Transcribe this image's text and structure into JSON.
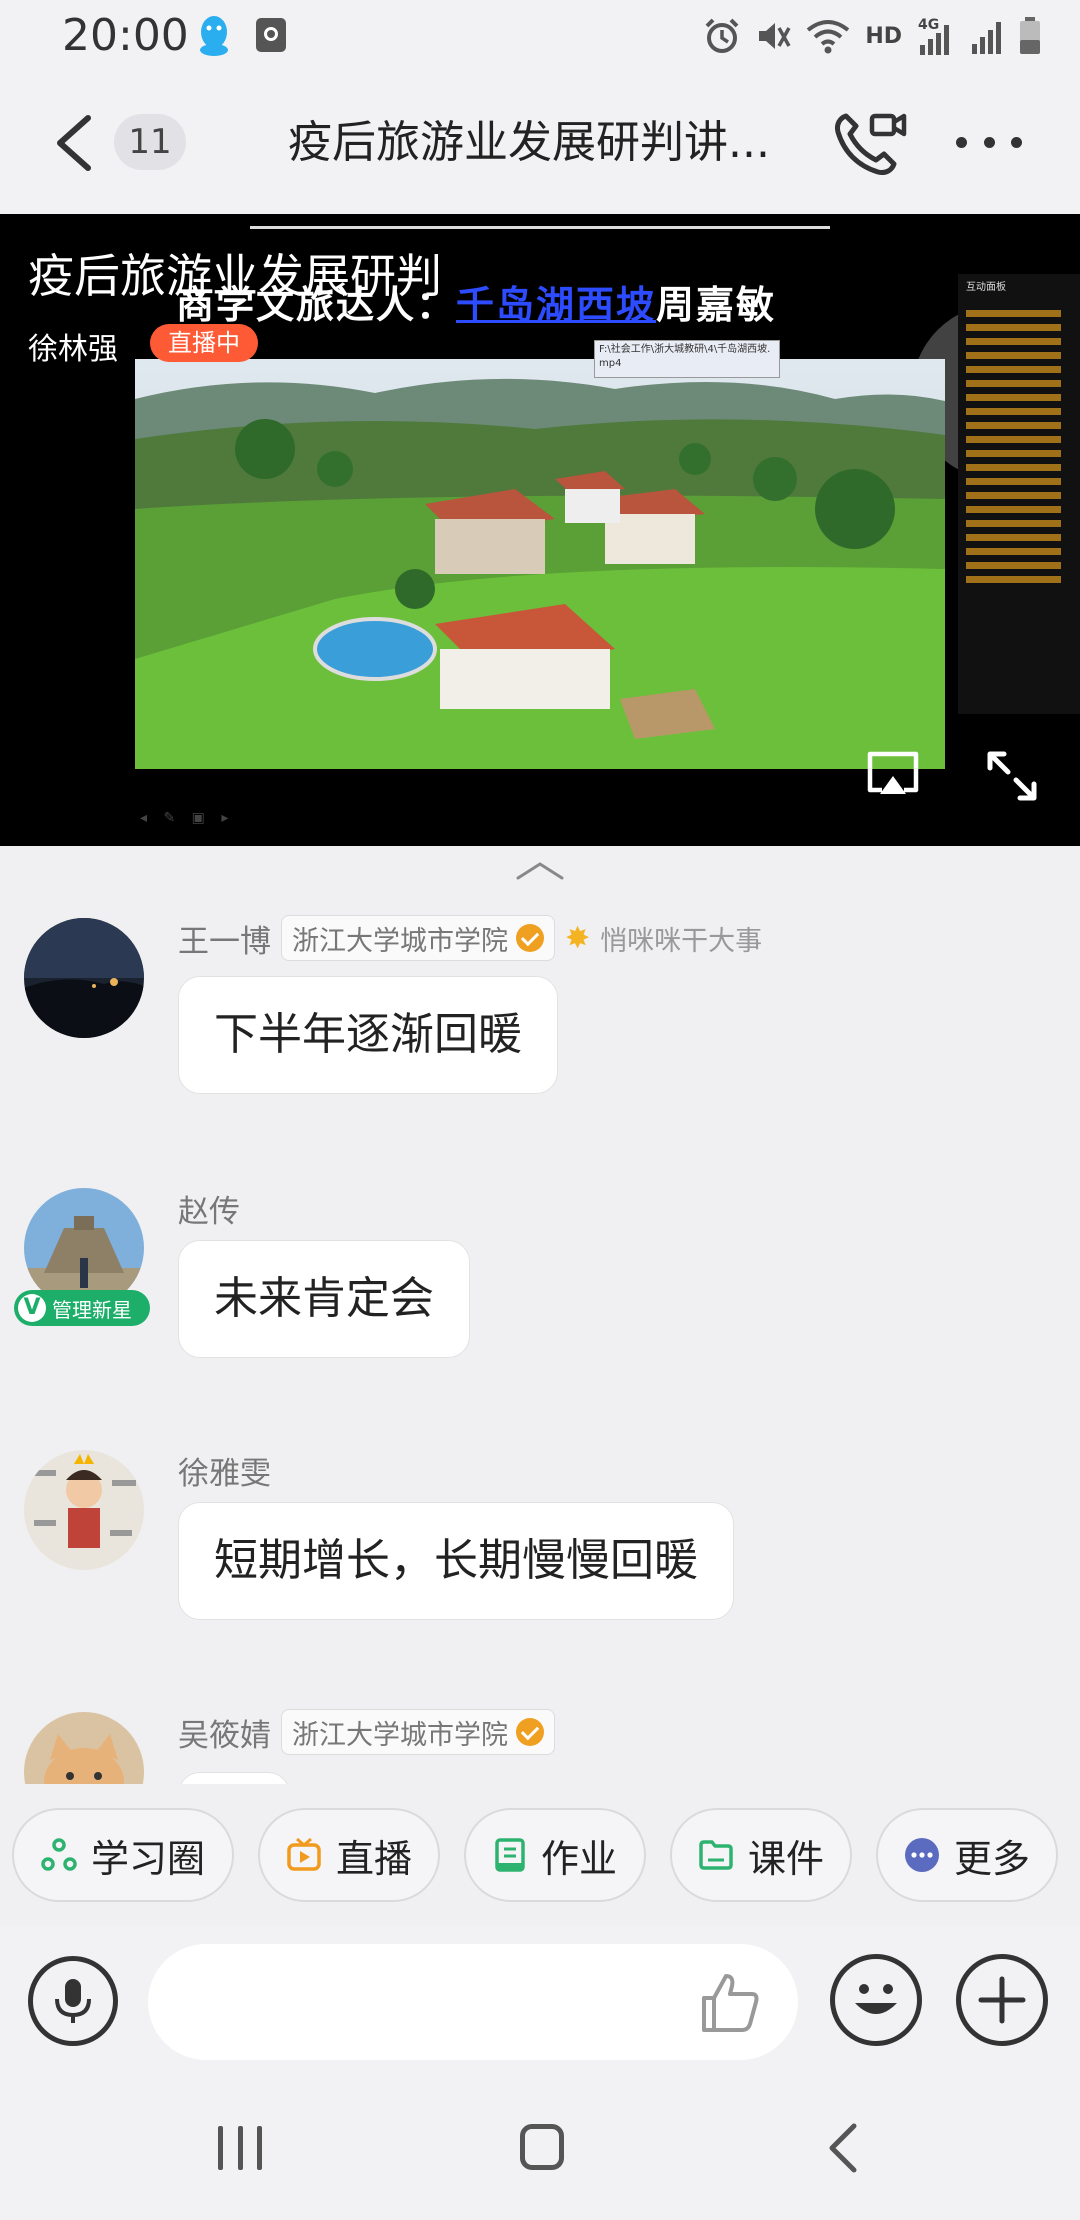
{
  "status_bar": {
    "time": "20:00",
    "network": "HD",
    "network_type": "4G"
  },
  "header": {
    "unread_count": "11",
    "title": "疫后旅游业发展研判讲..."
  },
  "live": {
    "title": "疫后旅游业发展研判",
    "presenter": "徐林强",
    "badge": "直播中",
    "slide_header_prefix": "商学文旅达人：",
    "slide_header_link": "千岛湖西坡",
    "slide_header_suffix": "周嘉敏",
    "slide_tooltip_line1": "F:\\社会工作\\浙大城教研\\4\\千岛湖西坡.",
    "slide_tooltip_line2": "mp4",
    "side_panel_title": "互动面板"
  },
  "messages": [
    {
      "sender": "王一博",
      "school": "浙江大学城市学院",
      "verified": true,
      "title": "悄咪咪干大事",
      "text": "下半年逐渐回暖"
    },
    {
      "sender": "赵传",
      "role_badge": "管理新星",
      "text": "未来肯定会"
    },
    {
      "sender": "徐雅雯",
      "text": "短期增长，长期慢慢回暖"
    },
    {
      "sender": "吴筱婧",
      "school": "浙江大学城市学院",
      "verified": true,
      "text": ""
    }
  ],
  "quick_tabs": [
    {
      "label": "学习圈",
      "icon": "circle-group-icon",
      "color": "#2db36f"
    },
    {
      "label": "直播",
      "icon": "tv-live-icon",
      "color": "#f29a1e"
    },
    {
      "label": "作业",
      "icon": "homework-book-icon",
      "color": "#2db36f"
    },
    {
      "label": "课件",
      "icon": "folder-icon",
      "color": "#2db36f"
    },
    {
      "label": "更多",
      "icon": "more-dots-icon",
      "color": "#5b6bc0"
    }
  ],
  "input": {
    "placeholder": ""
  }
}
